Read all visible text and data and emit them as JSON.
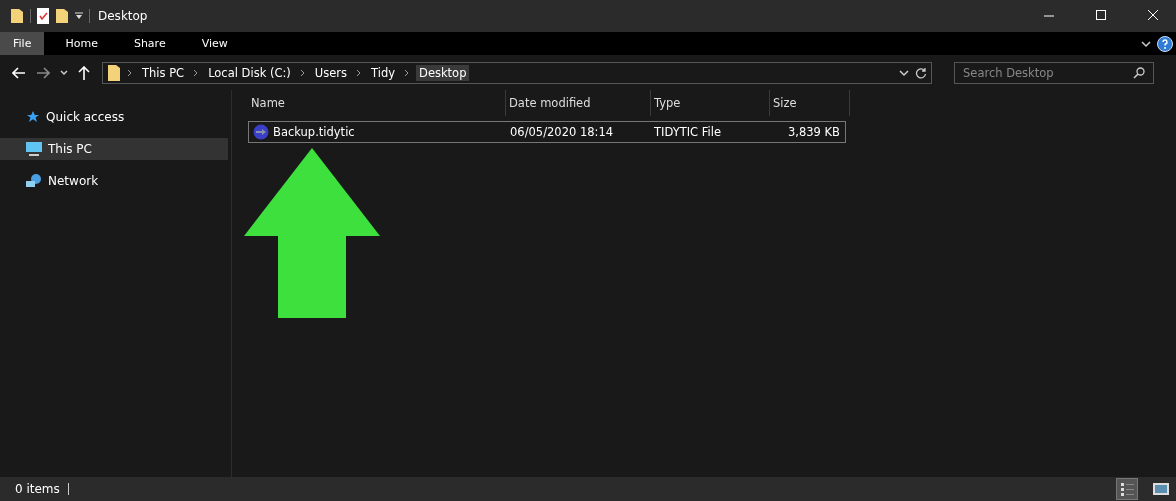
{
  "window": {
    "title": "Desktop"
  },
  "ribbon_tabs": [
    {
      "label": "File",
      "selected": true
    },
    {
      "label": "Home",
      "selected": false
    },
    {
      "label": "Share",
      "selected": false
    },
    {
      "label": "View",
      "selected": false
    }
  ],
  "breadcrumb": [
    "This PC",
    "Local Disk (C:)",
    "Users",
    "Tidy",
    "Desktop"
  ],
  "search": {
    "placeholder": "Search Desktop"
  },
  "sidebar": {
    "items": [
      {
        "label": "Quick access",
        "kind": "star",
        "selected": false
      },
      {
        "label": "This PC",
        "kind": "pc",
        "selected": true
      },
      {
        "label": "Network",
        "kind": "network",
        "selected": false
      }
    ]
  },
  "table": {
    "columns": [
      "Name",
      "Date modified",
      "Type",
      "Size"
    ],
    "rows": [
      {
        "name": "Backup.tidytic",
        "date": "06/05/2020 18:14",
        "type": "TIDYTIC File",
        "size": "3,839 KB",
        "focused": true
      }
    ]
  },
  "status_bar": {
    "text": "0 items",
    "views": [
      {
        "kind": "details",
        "selected": true
      },
      {
        "kind": "thumbnails",
        "selected": false
      }
    ]
  }
}
